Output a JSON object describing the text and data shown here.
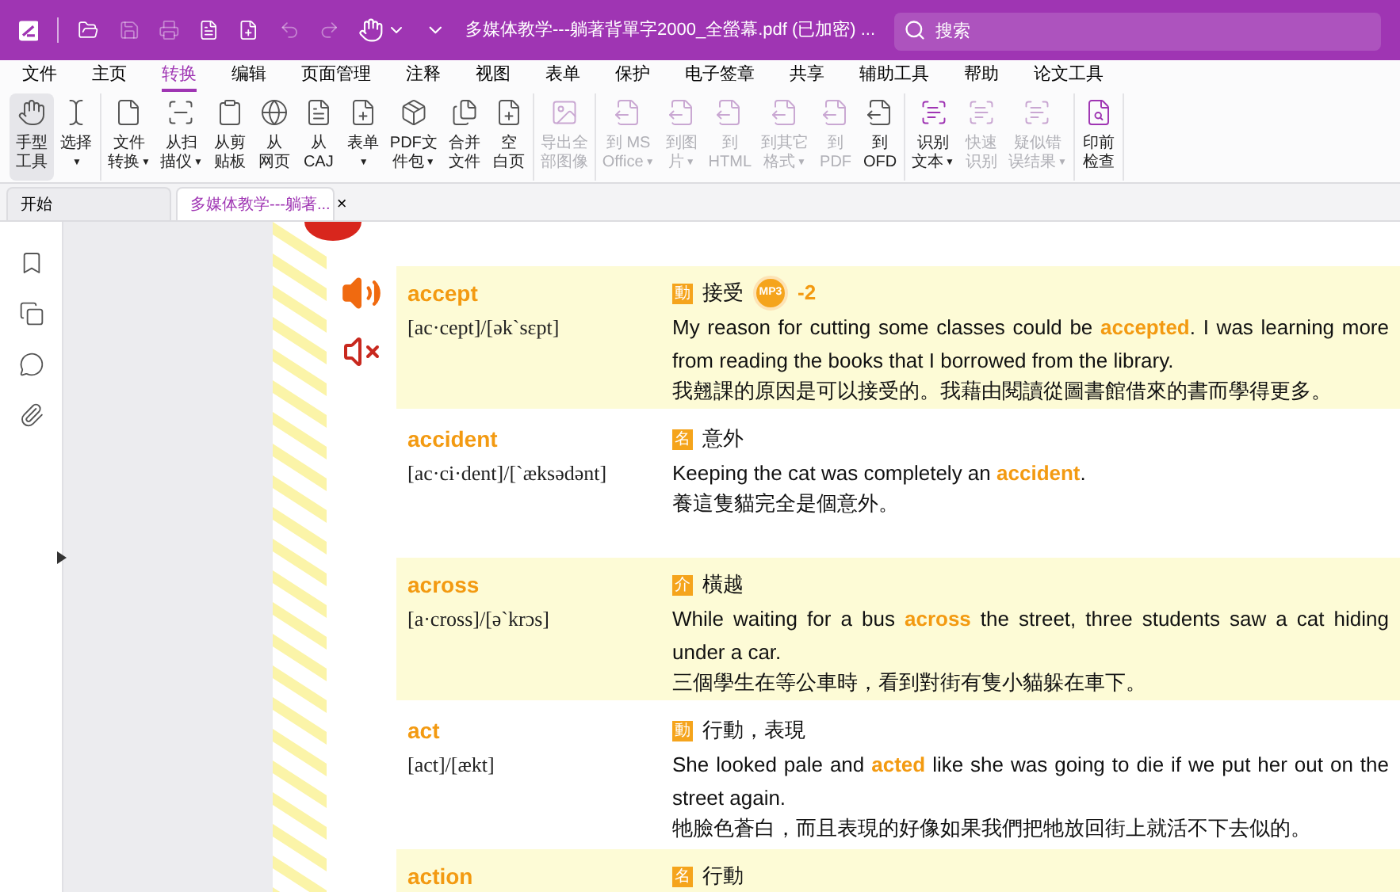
{
  "title_bar": {
    "title": "多媒体教学---躺著背單字2000_全螢幕.pdf (已加密) ...",
    "search": {
      "placeholder": "搜索"
    }
  },
  "menu_tabs": [
    {
      "label": "文件",
      "selected": false
    },
    {
      "label": "主页",
      "selected": false
    },
    {
      "label": "转换",
      "selected": true
    },
    {
      "label": "编辑",
      "selected": false
    },
    {
      "label": "页面管理",
      "selected": false
    },
    {
      "label": "注释",
      "selected": false
    },
    {
      "label": "视图",
      "selected": false
    },
    {
      "label": "表单",
      "selected": false
    },
    {
      "label": "保护",
      "selected": false
    },
    {
      "label": "电子签章",
      "selected": false
    },
    {
      "label": "共享",
      "selected": false
    },
    {
      "label": "辅助工具",
      "selected": false
    },
    {
      "label": "帮助",
      "selected": false
    },
    {
      "label": "论文工具",
      "selected": false
    }
  ],
  "ribbon_groups": [
    [
      {
        "lines": [
          "手型",
          "工具"
        ],
        "dropdown": false,
        "disabled": false,
        "selected": true
      },
      {
        "lines": [
          "选择"
        ],
        "dropdown": true,
        "disabled": false,
        "selected": false
      }
    ],
    [
      {
        "lines": [
          "文件",
          "转换"
        ],
        "dropdown": true,
        "disabled": false,
        "selected": false
      },
      {
        "lines": [
          "从扫",
          "描仪"
        ],
        "dropdown": true,
        "disabled": false,
        "selected": false
      },
      {
        "lines": [
          "从剪",
          "贴板"
        ],
        "dropdown": false,
        "disabled": false,
        "selected": false
      },
      {
        "lines": [
          "从",
          "网页"
        ],
        "dropdown": false,
        "disabled": false,
        "selected": false
      },
      {
        "lines": [
          "从",
          "CAJ"
        ],
        "dropdown": false,
        "disabled": false,
        "selected": false
      },
      {
        "lines": [
          "表单"
        ],
        "dropdown": true,
        "disabled": false,
        "selected": false
      },
      {
        "lines": [
          "PDF文",
          "件包"
        ],
        "dropdown": true,
        "disabled": false,
        "selected": false
      },
      {
        "lines": [
          "合并",
          "文件"
        ],
        "dropdown": false,
        "disabled": false,
        "selected": false
      },
      {
        "lines": [
          "空",
          "白页"
        ],
        "dropdown": false,
        "disabled": false,
        "selected": false
      }
    ],
    [
      {
        "lines": [
          "导出全",
          "部图像"
        ],
        "dropdown": false,
        "disabled": true,
        "selected": false
      }
    ],
    [
      {
        "lines": [
          "到 MS",
          "Office"
        ],
        "dropdown": true,
        "disabled": true,
        "selected": false
      },
      {
        "lines": [
          "到图",
          "片"
        ],
        "dropdown": true,
        "disabled": true,
        "selected": false
      },
      {
        "lines": [
          "到",
          "HTML"
        ],
        "dropdown": false,
        "disabled": true,
        "selected": false
      },
      {
        "lines": [
          "到其它",
          "格式"
        ],
        "dropdown": true,
        "disabled": true,
        "selected": false
      },
      {
        "lines": [
          "到",
          "PDF"
        ],
        "dropdown": false,
        "disabled": true,
        "selected": false
      },
      {
        "lines": [
          "到",
          "OFD"
        ],
        "dropdown": false,
        "disabled": false,
        "selected": false
      }
    ],
    [
      {
        "lines": [
          "识别",
          "文本"
        ],
        "dropdown": true,
        "disabled": false,
        "selected": false
      },
      {
        "lines": [
          "快速",
          "识别"
        ],
        "dropdown": false,
        "disabled": true,
        "selected": false
      },
      {
        "lines": [
          "疑似错",
          "误结果"
        ],
        "dropdown": true,
        "disabled": true,
        "selected": false
      }
    ],
    [
      {
        "lines": [
          "印前",
          "检查"
        ],
        "dropdown": false,
        "disabled": false,
        "selected": false
      }
    ]
  ],
  "doc_tabs": [
    {
      "label": "开始",
      "selected": false,
      "closable": false
    },
    {
      "label": "多媒体教学---躺著...",
      "selected": true,
      "closable": true
    }
  ],
  "close_glyph": "×",
  "caret": "▼",
  "entries": [
    {
      "word": "accept",
      "pron": "[ac·cept]/[ək`sɛpt]",
      "pos": "動",
      "meaning": "接受",
      "badge": "MP3",
      "badge_note": "-2",
      "sentence": "My reason for cutting some classes could be **accepted**. I was learning more from reading the books that I borrowed from the library.",
      "translation": "我翹課的原因是可以接受的。我藉由閱讀從圖書館借來的書而學得更多。",
      "shaded": true
    },
    {
      "word": "accident",
      "pron": "[ac·ci·dent]/[`æksədənt]",
      "pos": "名",
      "meaning": "意外",
      "sentence": "Keeping the cat was completely an **accident**.",
      "translation": "養這隻貓完全是個意外。",
      "shaded": false
    },
    {
      "word": "across",
      "pron": "[a·cross]/[ə`krɔs]",
      "pos": "介",
      "meaning": "橫越",
      "sentence": "While waiting for a bus **across** the street, three students saw a cat hiding under a car.",
      "translation": "三個學生在等公車時，看到對街有隻小貓躲在車下。",
      "shaded": true
    },
    {
      "word": "act",
      "pron": "[act]/[ækt]",
      "pos": "動",
      "meaning": "行動，表現",
      "sentence": "She looked pale and **acted** like she was going to die if we put her out on the street again.",
      "translation": "牠臉色蒼白，而且表現的好像如果我們把牠放回街上就活不下去似的。",
      "shaded": false
    },
    {
      "word": "action",
      "pos": "名",
      "meaning": "行動",
      "shaded": true
    }
  ]
}
